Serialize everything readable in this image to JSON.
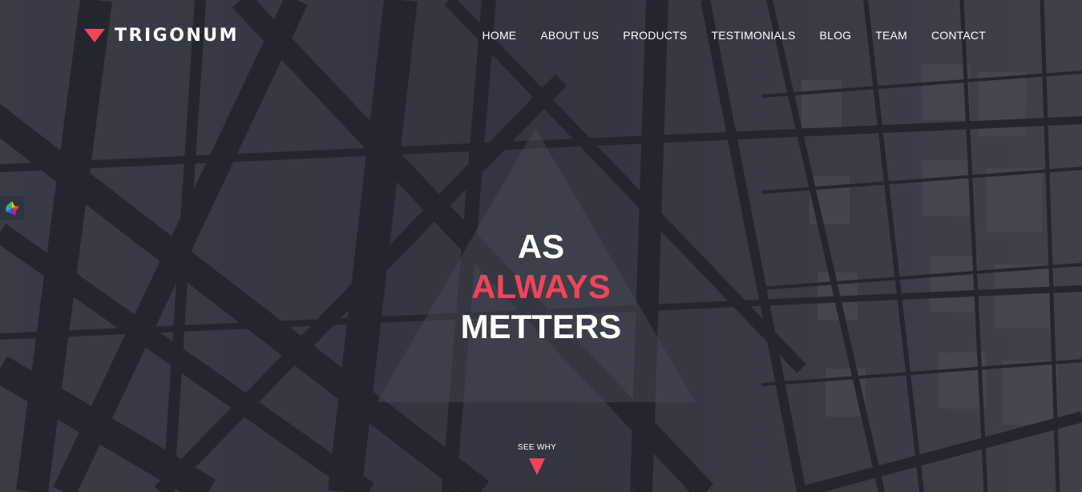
{
  "brand": {
    "name": "TRIGONUM",
    "accent_color": "#f0445b"
  },
  "nav": {
    "items": [
      {
        "label": "HOME"
      },
      {
        "label": "ABOUT US"
      },
      {
        "label": "PRODUCTS"
      },
      {
        "label": "TESTIMONIALS"
      },
      {
        "label": "BLOG"
      },
      {
        "label": "TEAM"
      },
      {
        "label": "CONTACT"
      }
    ]
  },
  "side_widget": {
    "icon": "color-palette-icon"
  },
  "hero": {
    "line1": "AS",
    "line2": "ALWAYS",
    "line3": "METTERS",
    "background": "steel-structure-photo"
  },
  "cta": {
    "label": "SEE WHY",
    "icon": "triangle-down-icon"
  }
}
